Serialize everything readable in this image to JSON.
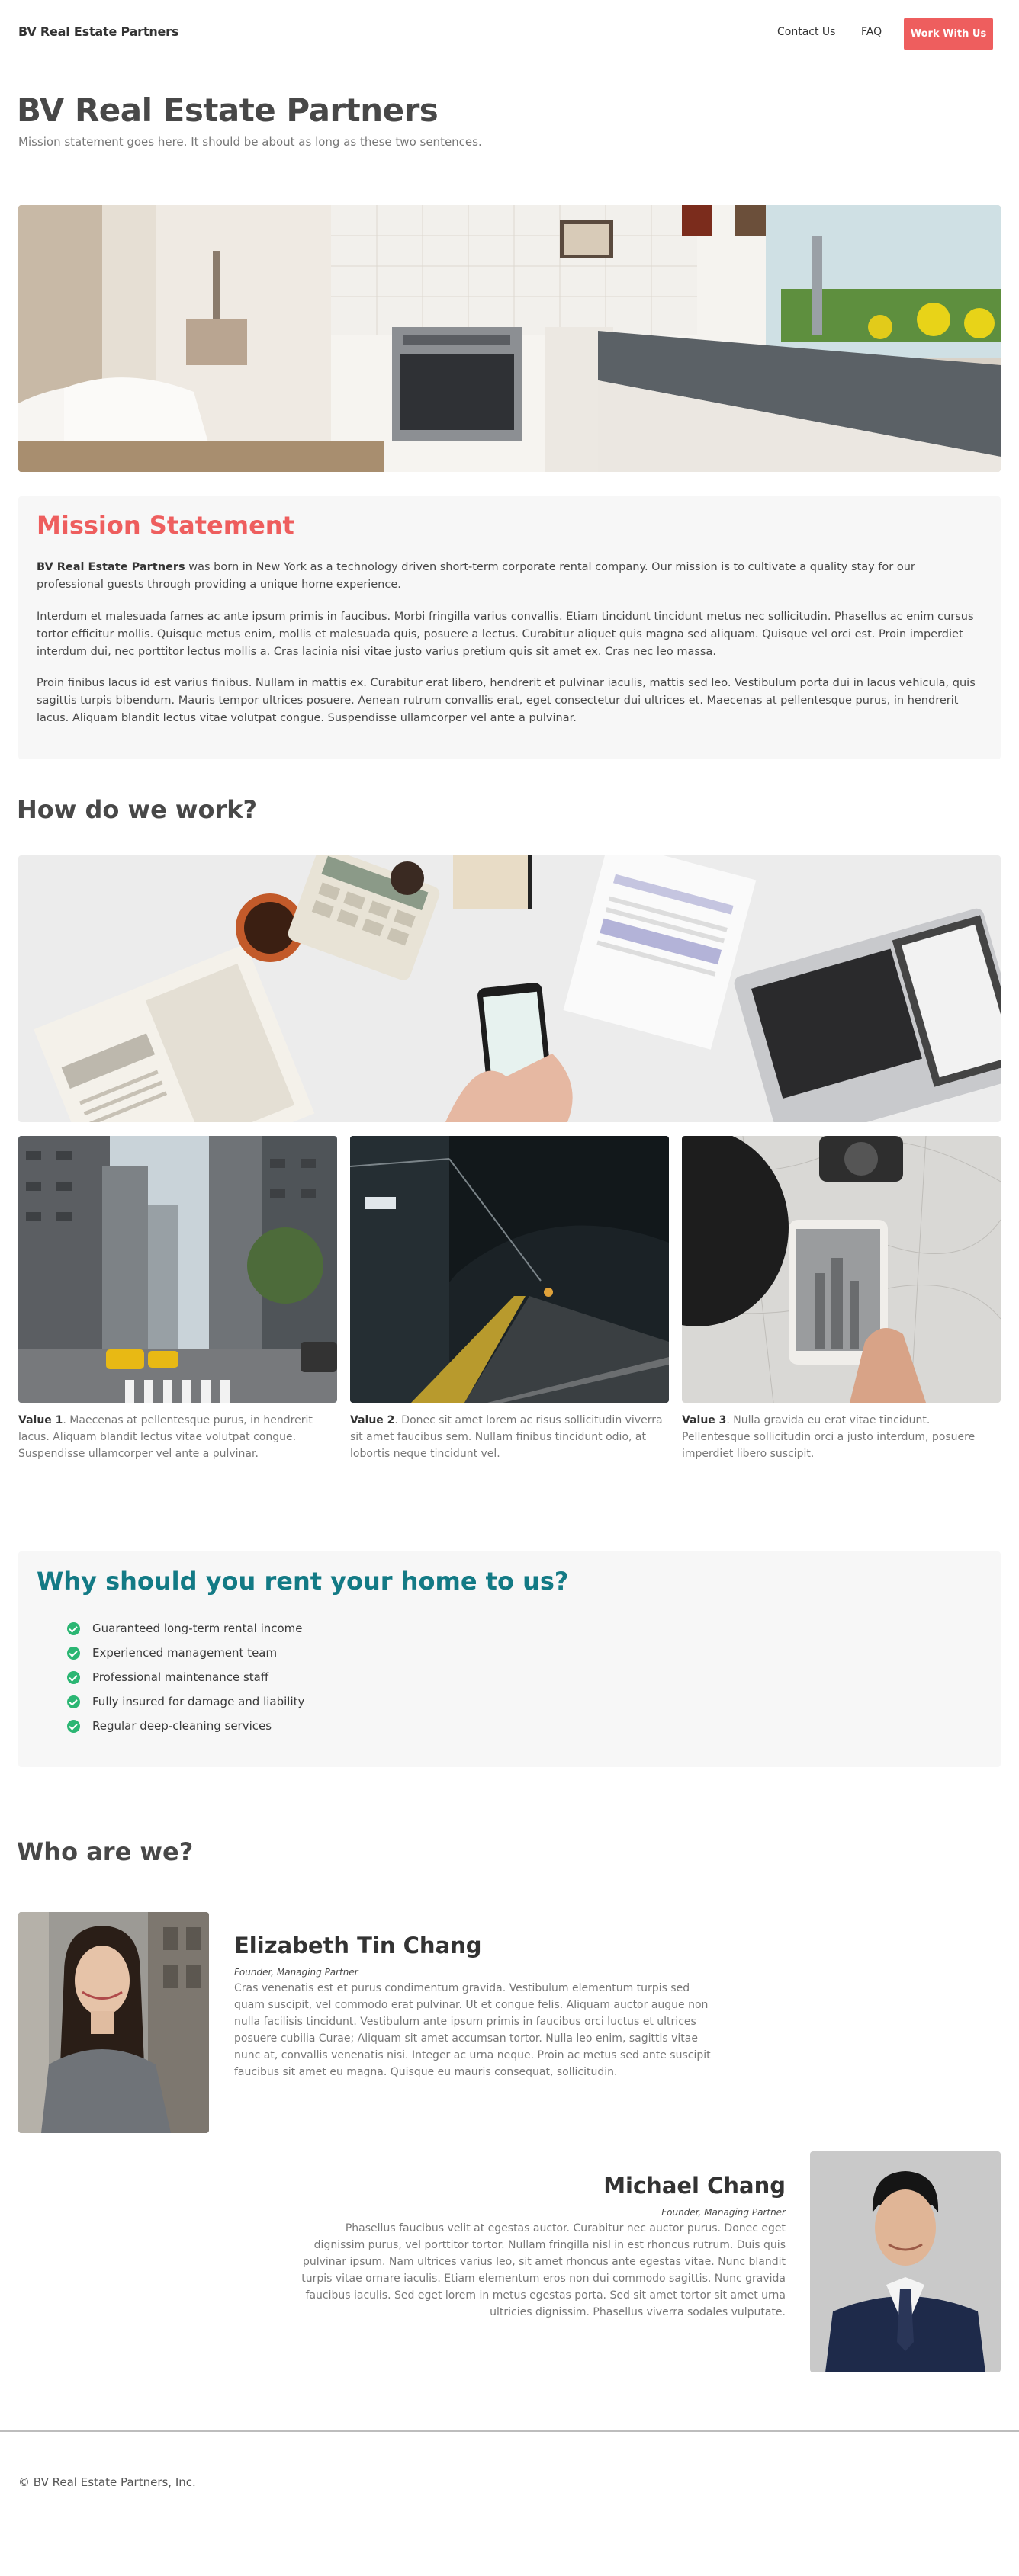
{
  "nav": {
    "brand": "BV Real Estate Partners",
    "links": [
      {
        "label": "Contact Us"
      },
      {
        "label": "FAQ"
      }
    ],
    "cta": "Work With Us"
  },
  "hero": {
    "title": "BV Real Estate Partners",
    "subtitle": "Mission statement goes here. It should be about as long as these two sentences."
  },
  "mission": {
    "title": "Mission Statement",
    "p1_strong": "BV Real Estate Partners",
    "p1_rest": " was born in New York as a technology driven short-term corporate rental company. Our mission is to cultivate a quality stay for our professional guests through providing a unique home experience.",
    "p2": "Interdum et malesuada fames ac ante ipsum primis in faucibus. Morbi fringilla varius convallis. Etiam tincidunt tincidunt metus nec sollicitudin. Phasellus ac enim cursus tortor efficitur mollis. Quisque metus enim, mollis et malesuada quis, posuere a lectus. Curabitur aliquet quis magna sed aliquam. Quisque vel orci est. Proin imperdiet interdum dui, nec porttitor lectus mollis a. Cras lacinia nisi vitae justo varius pretium quis sit amet ex. Cras nec leo massa.",
    "p3": "Proin finibus lacus id est varius finibus. Nullam in mattis ex. Curabitur erat libero, hendrerit et pulvinar iaculis, mattis sed leo. Vestibulum porta dui in lacus vehicula, quis sagittis turpis bibendum. Mauris tempor ultrices posuere. Aenean rutrum convallis erat, eget consectetur dui ultrices et. Maecenas at pellentesque purus, in hendrerit lacus. Aliquam blandit lectus vitae volutpat congue. Suspendisse ullamcorper vel ante a pulvinar."
  },
  "how": {
    "title": "How do we work?",
    "values": [
      {
        "label": "Value 1",
        "text": ". Maecenas at pellentesque purus, in hendrerit lacus. Aliquam blandit lectus vitae volutpat congue. Suspendisse ullamcorper vel ante a pulvinar."
      },
      {
        "label": "Value 2",
        "text": ". Donec sit amet lorem ac risus sollicitudin viverra sit amet faucibus sem. Nullam finibus tincidunt odio, at lobortis neque tincidunt vel."
      },
      {
        "label": "Value 3",
        "text": ". Nulla gravida eu erat vitae tincidunt. Pellentesque sollicitudin orci a justo interdum, posuere imperdiet libero suscipit."
      }
    ]
  },
  "why": {
    "title": "Why should you rent your home to us?",
    "items": [
      "Guaranteed long-term rental income",
      "Experienced management team",
      "Professional maintenance staff",
      "Fully insured for damage and liability",
      "Regular deep-cleaning services"
    ]
  },
  "team": {
    "title": "Who are we?",
    "people": [
      {
        "name": "Elizabeth Tin Chang",
        "role": "Founder, Managing Partner",
        "bio": "Cras venenatis est et purus condimentum gravida. Vestibulum elementum turpis sed quam suscipit, vel commodo erat pulvinar. Ut et congue felis. Aliquam auctor augue non nulla facilisis tincidunt. Vestibulum ante ipsum primis in faucibus orci luctus et ultrices posuere cubilia Curae; Aliquam sit amet accumsan tortor. Nulla leo enim, sagittis vitae nunc at, convallis venenatis nisi. Integer ac urna neque. Proin ac metus sed ante suscipit faucibus sit amet eu magna. Quisque eu mauris consequat, sollicitudin."
      },
      {
        "name": "Michael Chang",
        "role": "Founder, Managing Partner",
        "bio": "Phasellus faucibus velit at egestas auctor. Curabitur nec auctor purus. Donec eget dignissim purus, vel porttitor tortor. Nullam fringilla nisl in est rhoncus rutrum. Duis quis pulvinar ipsum. Nam ultrices varius leo, sit amet rhoncus ante egestas vitae. Nunc blandit turpis vitae ornare iaculis. Etiam elementum eros non dui commodo sagittis. Nunc gravida faucibus iaculis. Sed eget lorem in metus egestas porta. Sed sit amet tortor sit amet urna ultricies dignissim. Phasellus viverra sodales vulputate."
      }
    ]
  },
  "footer": {
    "copyright": "© BV Real Estate Partners, Inc."
  },
  "colors": {
    "accent": "#ee5e5e",
    "teal": "#137a85",
    "check": "#2bb673",
    "panel": "#f7f7f7"
  }
}
